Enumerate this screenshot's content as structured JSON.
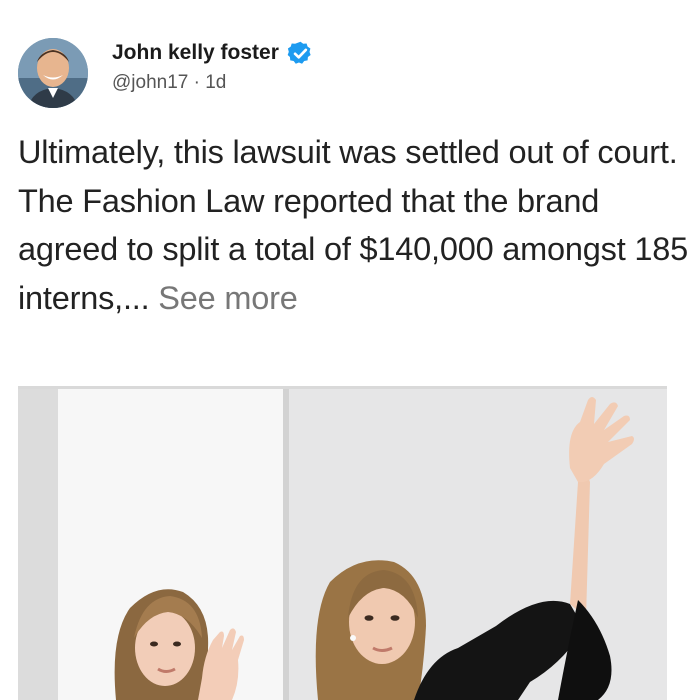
{
  "post": {
    "author": {
      "display_name": "John kelly foster",
      "handle": "@john17",
      "separator": "·",
      "time": "1d",
      "verified": true
    },
    "text": "Ultimately, this lawsuit was settled out of court. The Fashion Law reported that the brand agreed to split a total of $140,000 amongst 185 interns,... ",
    "see_more_label": "See more",
    "image": {
      "icon": "photo-two-women-raising-hands"
    }
  },
  "colors": {
    "verified_badge": "#1d9bf0",
    "see_more": "#777777",
    "text": "#222222"
  }
}
